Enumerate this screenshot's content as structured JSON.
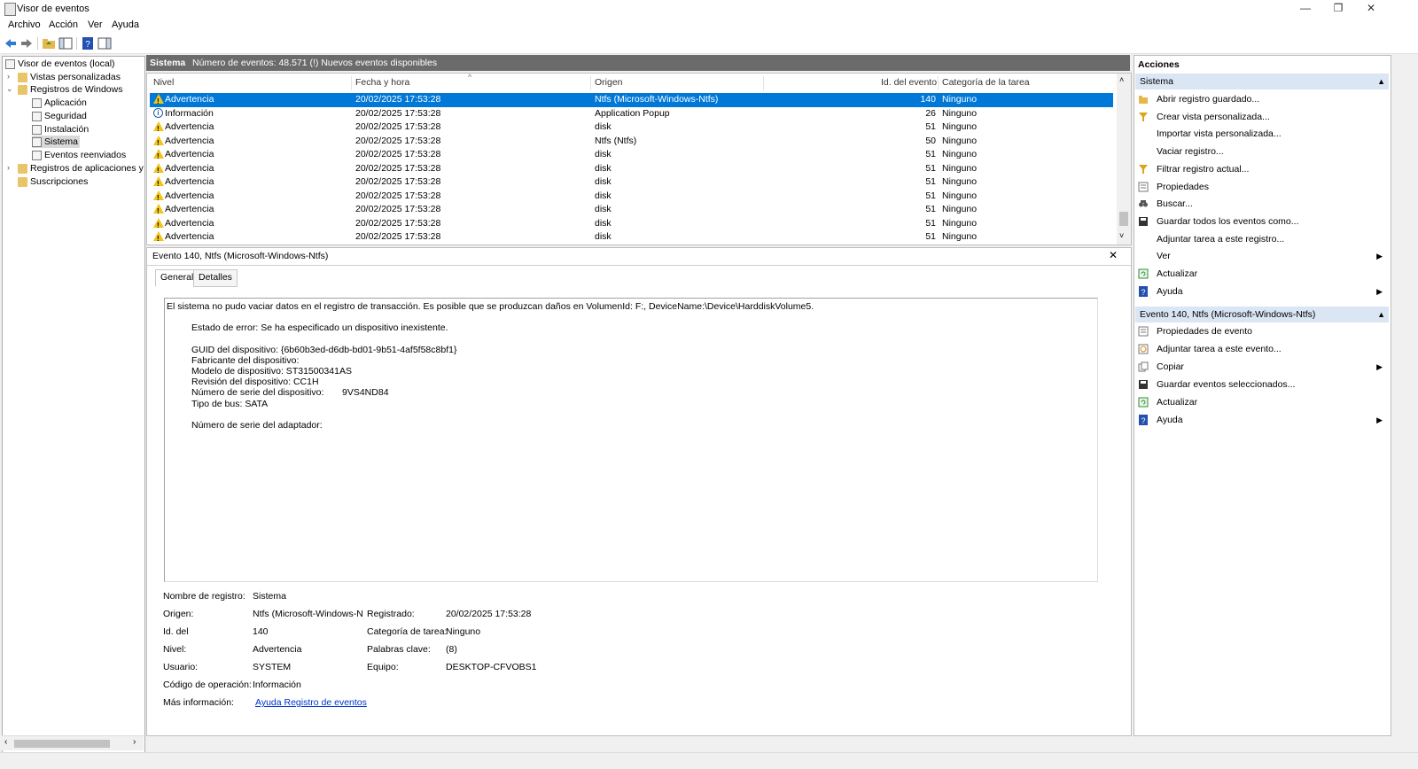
{
  "window": {
    "title": "Visor de eventos",
    "controls": {
      "minimize": "—",
      "restore": "❐",
      "close": "✕"
    }
  },
  "menu": [
    "Archivo",
    "Acción",
    "Ver",
    "Ayuda"
  ],
  "tree": {
    "items": [
      {
        "label": "Visor de eventos (local)"
      },
      {
        "label": "Vistas personalizadas"
      },
      {
        "label": "Registros de Windows"
      },
      {
        "label": "Aplicación"
      },
      {
        "label": "Seguridad"
      },
      {
        "label": "Instalación"
      },
      {
        "label": "Sistema"
      },
      {
        "label": "Eventos reenviados"
      },
      {
        "label": "Registros de aplicaciones y s"
      },
      {
        "label": "Suscripciones"
      }
    ]
  },
  "center_header": {
    "log_name": "Sistema",
    "event_count": "Número de eventos: 48.571 (!) Nuevos eventos disponibles"
  },
  "table": {
    "columns": [
      "Nivel",
      "Fecha y hora",
      "Origen",
      "Id. del evento",
      "Categoría de la tarea"
    ],
    "rows": [
      {
        "level": "Advertencia",
        "icon": "warning-icon",
        "date": "20/02/2025 17:53:28",
        "source": "Ntfs (Microsoft-Windows-Ntfs)",
        "id": "140",
        "category": "Ninguno"
      },
      {
        "level": "Información",
        "icon": "info-icon",
        "date": "20/02/2025 17:53:28",
        "source": "Application Popup",
        "id": "26",
        "category": "Ninguno"
      },
      {
        "level": "Advertencia",
        "icon": "warning-icon",
        "date": "20/02/2025 17:53:28",
        "source": "disk",
        "id": "51",
        "category": "Ninguno"
      },
      {
        "level": "Advertencia",
        "icon": "warning-icon",
        "date": "20/02/2025 17:53:28",
        "source": "Ntfs (Ntfs)",
        "id": "50",
        "category": "Ninguno"
      },
      {
        "level": "Advertencia",
        "icon": "warning-icon",
        "date": "20/02/2025 17:53:28",
        "source": "disk",
        "id": "51",
        "category": "Ninguno"
      },
      {
        "level": "Advertencia",
        "icon": "warning-icon",
        "date": "20/02/2025 17:53:28",
        "source": "disk",
        "id": "51",
        "category": "Ninguno"
      },
      {
        "level": "Advertencia",
        "icon": "warning-icon",
        "date": "20/02/2025 17:53:28",
        "source": "disk",
        "id": "51",
        "category": "Ninguno"
      },
      {
        "level": "Advertencia",
        "icon": "warning-icon",
        "date": "20/02/2025 17:53:28",
        "source": "disk",
        "id": "51",
        "category": "Ninguno"
      },
      {
        "level": "Advertencia",
        "icon": "warning-icon",
        "date": "20/02/2025 17:53:28",
        "source": "disk",
        "id": "51",
        "category": "Ninguno"
      },
      {
        "level": "Advertencia",
        "icon": "warning-icon",
        "date": "20/02/2025 17:53:28",
        "source": "disk",
        "id": "51",
        "category": "Ninguno"
      },
      {
        "level": "Advertencia",
        "icon": "warning-icon",
        "date": "20/02/2025 17:53:28",
        "source": "disk",
        "id": "51",
        "category": "Ninguno"
      }
    ]
  },
  "detail": {
    "title": "Evento 140, Ntfs (Microsoft-Windows-Ntfs)",
    "close": "✕",
    "tabs": [
      "General",
      "Detalles"
    ],
    "message": {
      "line1": "El sistema no pudo vaciar datos en el registro de transacción. Es posible que se produzcan daños en VolumenId: F:, DeviceName:\\Device\\HarddiskVolume5.",
      "error_state": "Estado de error: Se ha especificado un dispositivo inexistente.",
      "guid": "GUID del dispositivo: {6b60b3ed-d6db-bd01-9b51-4af5f58c8bf1}",
      "manufacturer": "Fabricante del dispositivo:",
      "model": "Modelo de dispositivo: ST31500341AS",
      "revision": "Revisión del dispositivo: CC1H",
      "serial_label": "Número de serie del dispositivo:",
      "serial_value": "9VS4ND84",
      "bus": "Tipo de bus: SATA",
      "adapter_serial": "Número de serie del adaptador:"
    },
    "props": {
      "log_name_label": "Nombre de registro:",
      "log_name": "Sistema",
      "source_label": "Origen:",
      "source": "Ntfs (Microsoft-Windows-N",
      "logged_label": "Registrado:",
      "logged": "20/02/2025 17:53:28",
      "event_id_label": "Id. del",
      "event_id": "140",
      "task_label": "Categoría de tarea:",
      "task": "Ninguno",
      "level_label": "Nivel:",
      "level": "Advertencia",
      "keywords_label": "Palabras clave:",
      "keywords": "(8)",
      "user_label": "Usuario:",
      "user": "SYSTEM",
      "computer_label": "Equipo:",
      "computer": "DESKTOP-CFVOBS1",
      "opcode_label": "Código de operación:",
      "opcode": "Información",
      "more_label": "Más información:",
      "more_link": "Ayuda Registro de eventos"
    }
  },
  "actions": {
    "title": "Acciones",
    "section1": {
      "title": "Sistema",
      "items": [
        {
          "label": "Abrir registro guardado...",
          "icon": "open-folder-icon"
        },
        {
          "label": "Crear vista personalizada...",
          "icon": "filter-icon"
        },
        {
          "label": "Importar vista personalizada...",
          "icon": ""
        },
        {
          "label": "Vaciar registro...",
          "icon": ""
        },
        {
          "label": "Filtrar registro actual...",
          "icon": "filter-icon"
        },
        {
          "label": "Propiedades",
          "icon": "properties-icon"
        },
        {
          "label": "Buscar...",
          "icon": "binoculars-icon"
        },
        {
          "label": "Guardar todos los eventos como...",
          "icon": "save-icon"
        },
        {
          "label": "Adjuntar tarea a este registro...",
          "icon": ""
        },
        {
          "label": "Ver",
          "icon": "",
          "submenu": true
        },
        {
          "label": "Actualizar",
          "icon": "refresh-icon"
        },
        {
          "label": "Ayuda",
          "icon": "help-icon",
          "submenu": true
        }
      ]
    },
    "section2": {
      "title": "Evento 140, Ntfs (Microsoft-Windows-Ntfs)",
      "items": [
        {
          "label": "Propiedades de evento",
          "icon": "properties-icon"
        },
        {
          "label": "Adjuntar tarea a este evento...",
          "icon": "task-icon"
        },
        {
          "label": "Copiar",
          "icon": "copy-icon",
          "submenu": true
        },
        {
          "label": "Guardar eventos seleccionados...",
          "icon": "save-icon"
        },
        {
          "label": "Actualizar",
          "icon": "refresh-icon"
        },
        {
          "label": "Ayuda",
          "icon": "help-icon",
          "submenu": true
        }
      ]
    }
  },
  "colors": {
    "selection": "#0078d7",
    "header_dark": "#6b6b6b",
    "action_section": "#dbe6f4",
    "warning": "#f0c419"
  }
}
